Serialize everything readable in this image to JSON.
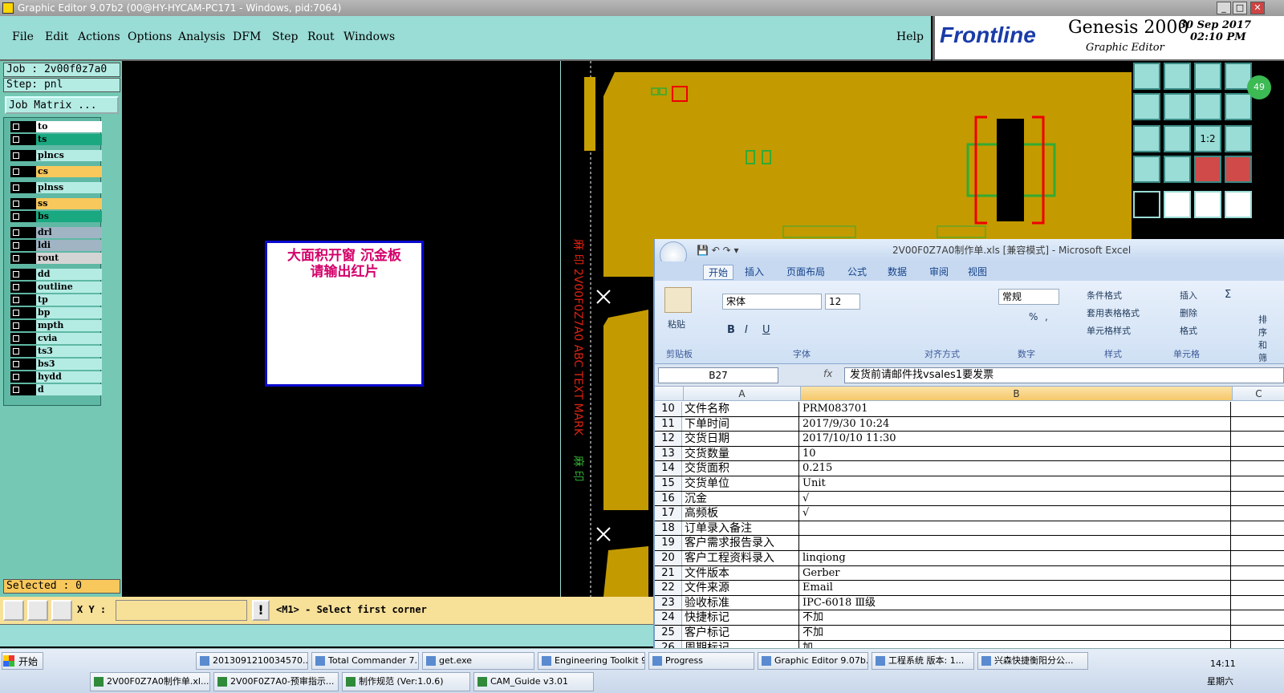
{
  "window": {
    "title": "Graphic Editor 9.07b2 (00@HY-HYCAM-PC171 - Windows, pid:7064)"
  },
  "menu": {
    "file": "File",
    "edit": "Edit",
    "actions": "Actions",
    "options": "Options",
    "analysis": "Analysis",
    "dfm": "DFM",
    "step": "Step",
    "rout": "Rout",
    "windows": "Windows",
    "help": "Help"
  },
  "brand": {
    "logo": "Frontline",
    "product": "Genesis 2000",
    "subtitle": "Graphic Editor",
    "date": "30 Sep 2017",
    "time": "02:10 PM"
  },
  "left": {
    "job": "Job : 2v00f0z7a0",
    "step": "Step: pnl",
    "job_matrix": "Job Matrix ...",
    "selected": "Selected : 0"
  },
  "layers": [
    {
      "name": "to",
      "color": "#ffffff"
    },
    {
      "name": "ts",
      "color": "#1aa880"
    },
    {
      "name": "plncs",
      "color": "#b4ece4"
    },
    {
      "name": "cs",
      "color": "#f8c85c"
    },
    {
      "name": "plnss",
      "color": "#b4ece4"
    },
    {
      "name": "ss",
      "color": "#f8c85c"
    },
    {
      "name": "bs",
      "color": "#1aa880"
    },
    {
      "name": "drl",
      "color": "#a0b4c4"
    },
    {
      "name": "ldi",
      "color": "#a0b4c4"
    },
    {
      "name": "rout",
      "color": "#d4d4d4"
    },
    {
      "name": "dd",
      "color": "#b4ece4"
    },
    {
      "name": "outline",
      "color": "#b4ece4"
    },
    {
      "name": "tp",
      "color": "#b4ece4"
    },
    {
      "name": "bp",
      "color": "#b4ece4"
    },
    {
      "name": "mpth",
      "color": "#b4ece4"
    },
    {
      "name": "cvia",
      "color": "#b4ece4"
    },
    {
      "name": "ts3",
      "color": "#b4ece4"
    },
    {
      "name": "bs3",
      "color": "#b4ece4"
    },
    {
      "name": "hydd",
      "color": "#b4ece4"
    },
    {
      "name": "d",
      "color": "#b4ece4"
    }
  ],
  "canvas": {
    "note_line1": "大面积开窗 沉金板",
    "note_line2": "请输出红片"
  },
  "cmd": {
    "xy_label": "X Y :",
    "xy_value": "",
    "prompt": "<M1> - Select first corner"
  },
  "tools": {
    "badge": "49",
    "ratio": "1:2"
  },
  "excel": {
    "title": "2V00F0Z7A0制作单.xls [兼容模式] - Microsoft Excel",
    "tabs": [
      "开始",
      "插入",
      "页面布局",
      "公式",
      "数据",
      "审阅",
      "视图"
    ],
    "ribbon": {
      "paste": "粘贴",
      "clipboard": "剪贴板",
      "font_name": "宋体",
      "font_size": "12",
      "font_group": "字体",
      "align_group": "对齐方式",
      "number_format": "常规",
      "number_group": "数字",
      "cond_fmt": "条件格式",
      "table_fmt": "套用表格格式",
      "cell_style": "单元格样式",
      "style_group": "样式",
      "insert": "插入",
      "delete": "删除",
      "format": "格式",
      "cells_group": "单元格",
      "sort": "排序和筛选",
      "bold": "B",
      "italic": "I",
      "underline": "U",
      "percent": "%",
      "comma": ",",
      "sigma": "Σ"
    },
    "name_box": "B27",
    "formula": "发货前请邮件找vsales1要发票",
    "col_a": "A",
    "col_b": "B",
    "col_c": "C",
    "rows": [
      {
        "n": "10",
        "a": "文件名称",
        "b": "PRM083701"
      },
      {
        "n": "11",
        "a": "下单时间",
        "b": "2017/9/30 10:24"
      },
      {
        "n": "12",
        "a": "交货日期",
        "b": "2017/10/10 11:30"
      },
      {
        "n": "13",
        "a": "交货数量",
        "b": "10"
      },
      {
        "n": "14",
        "a": "交货面积",
        "b": "0.215"
      },
      {
        "n": "15",
        "a": "交货单位",
        "b": "Unit"
      },
      {
        "n": "16",
        "a": "沉金",
        "b": "√"
      },
      {
        "n": "17",
        "a": "高频板",
        "b": "√"
      },
      {
        "n": "18",
        "a": "订单录入备注",
        "b": ""
      },
      {
        "n": "19",
        "a": "客户需求报告录入",
        "b": ""
      },
      {
        "n": "20",
        "a": "客户工程资料录入",
        "b": "linqiong"
      },
      {
        "n": "21",
        "a": "文件版本",
        "b": "Gerber"
      },
      {
        "n": "22",
        "a": "文件来源",
        "b": "Email"
      },
      {
        "n": "23",
        "a": "验收标准",
        "b": "IPC-6018 Ⅲ级"
      },
      {
        "n": "24",
        "a": "快捷标记",
        "b": "不加"
      },
      {
        "n": "25",
        "a": "客户标记",
        "b": "不加"
      },
      {
        "n": "26",
        "a": "周期标记",
        "b": "加"
      }
    ]
  },
  "taskbar": {
    "start": "开始",
    "tasks_top": [
      "2013091210034570....",
      "Total Commander 7....",
      "get.exe",
      "Engineering Toolkit 9...",
      "Progress",
      "Graphic Editor 9.07b...",
      "工程系统  版本: 1...",
      "兴森快捷衡阳分公..."
    ],
    "tasks_bottom": [
      "2V00F0Z7A0制作单.xl...",
      "2V00F0Z7A0-预审指示...",
      "制作规范 (Ver:1.0.6)",
      "CAM_Guide v3.01"
    ],
    "clock": "14:11",
    "weekday": "星期六"
  }
}
